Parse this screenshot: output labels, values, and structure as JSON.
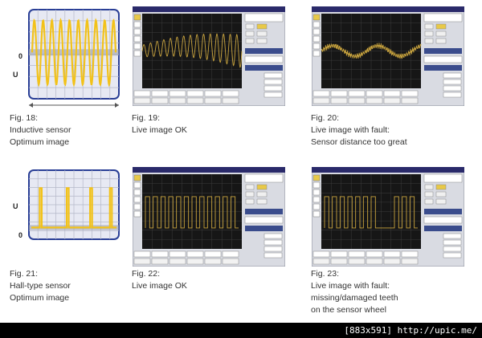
{
  "figures": [
    {
      "id": "fig18",
      "kind": "diagram",
      "wave": "sine",
      "axis_u": "U",
      "axis_zero": "0",
      "caption": [
        "Fig. 18:",
        "Inductive sensor",
        "Optimum image"
      ]
    },
    {
      "id": "fig19",
      "kind": "scope",
      "wave": "sine-ok",
      "caption": [
        "Fig. 19:",
        "Live image OK"
      ]
    },
    {
      "id": "fig20",
      "kind": "scope",
      "wave": "noise",
      "caption": [
        "Fig. 20:",
        "Live image with fault:",
        "Sensor distance too great"
      ]
    },
    {
      "id": "fig21",
      "kind": "diagram",
      "wave": "pulse",
      "axis_u": "U",
      "axis_zero": "0",
      "caption": [
        "Fig. 21:",
        "Hall-type sensor",
        "Optimum image"
      ]
    },
    {
      "id": "fig22",
      "kind": "scope",
      "wave": "square",
      "caption": [
        "Fig. 22:",
        "Live image OK"
      ]
    },
    {
      "id": "fig23",
      "kind": "scope",
      "wave": "square-gap",
      "caption": [
        "Fig. 23:",
        "Live image with fault:",
        "missing/damaged teeth",
        "on the sensor wheel"
      ]
    }
  ],
  "footer": "[883x591] http://upic.me/",
  "colors": {
    "wave": "#f2c21a",
    "grid": "#b4b8c8",
    "diagram_bg": "#e7e9f3",
    "diagram_frame": "#2a3f96",
    "scope_screen": "#161616",
    "scope_wave": "#c9a43e",
    "scope_ui": "#d9dbe2"
  }
}
